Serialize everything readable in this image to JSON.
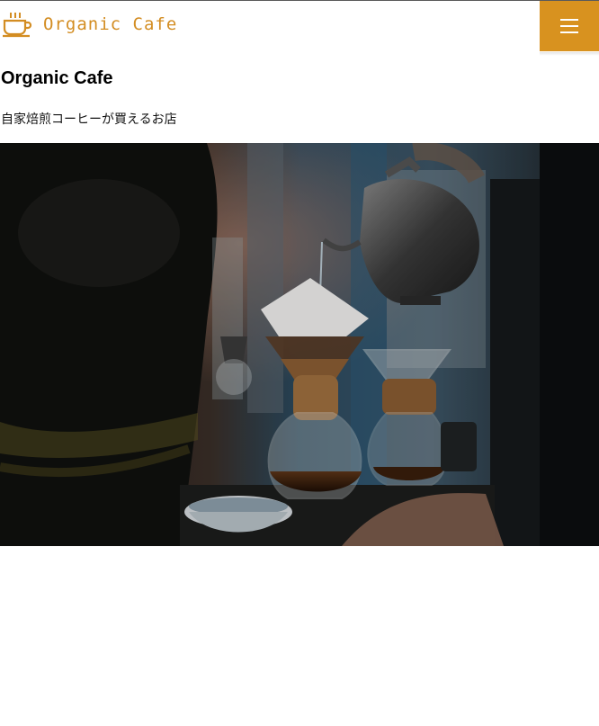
{
  "header": {
    "logo_text": "Organic Cafe",
    "logo_icon": "coffee-cup-icon",
    "menu_icon": "hamburger-menu-icon",
    "accent_color": "#d8921f"
  },
  "main": {
    "title": "Organic Cafe",
    "subtitle": "自家焙煎コーヒーが買えるお店"
  },
  "hero": {
    "image_subject": "pour-over-coffee-photo"
  }
}
